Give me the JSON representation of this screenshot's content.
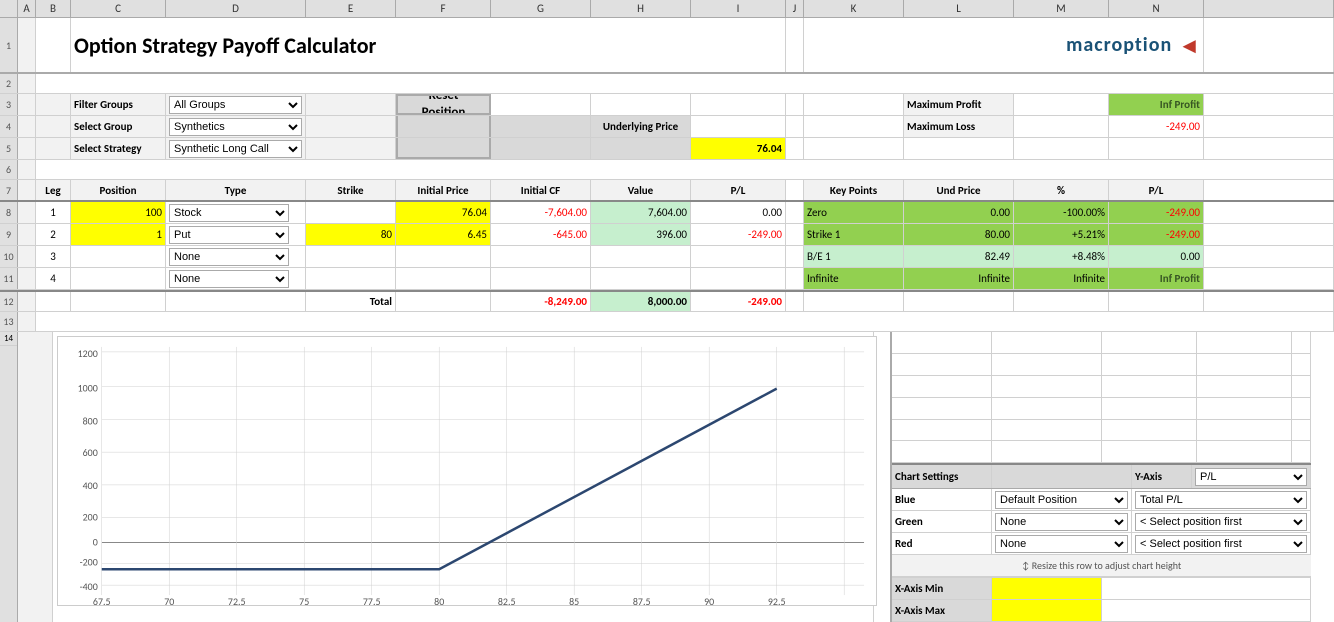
{
  "title": "Option Strategy Payoff Calculator",
  "logo": "macroption",
  "filters": {
    "filter_groups_label": "Filter Groups",
    "select_group_label": "Select Group",
    "select_strategy_label": "Select Strategy",
    "filter_groups_value": "All Groups",
    "select_group_value": "Synthetics",
    "select_strategy_value": "Synthetic Long Call",
    "filter_groups_options": [
      "All Groups"
    ],
    "select_group_options": [
      "Synthetics"
    ],
    "select_strategy_options": [
      "Synthetic Long Call"
    ]
  },
  "reset_button": "Reset\nPosition",
  "underlying_price_label": "Underlying Price",
  "underlying_price_value": "76.04",
  "table_headers": [
    "Leg",
    "Position",
    "Type",
    "Strike",
    "Initial Price",
    "Initial CF",
    "Value",
    "P/L"
  ],
  "legs": [
    {
      "leg": "1",
      "position": "100",
      "type": "Stock",
      "strike": "",
      "initial_price": "76.04",
      "initial_cf": "-7,604.00",
      "value": "7,604.00",
      "pl": "0.00"
    },
    {
      "leg": "2",
      "position": "1",
      "type": "Put",
      "strike": "80",
      "initial_price": "6.45",
      "initial_cf": "-645.00",
      "value": "396.00",
      "pl": "-249.00"
    },
    {
      "leg": "3",
      "position": "",
      "type": "None",
      "strike": "",
      "initial_price": "",
      "initial_cf": "",
      "value": "",
      "pl": ""
    },
    {
      "leg": "4",
      "position": "",
      "type": "None",
      "strike": "",
      "initial_price": "",
      "initial_cf": "",
      "value": "",
      "pl": ""
    }
  ],
  "totals": {
    "label": "Total",
    "initial_cf": "-8,249.00",
    "value": "8,000.00",
    "pl": "-249.00"
  },
  "key_points": {
    "headers": [
      "Key Points",
      "Und Price",
      "%",
      "P/L"
    ],
    "rows": [
      {
        "label": "Zero",
        "und_price": "0.00",
        "pct": "-100.00%",
        "pl": "-249.00"
      },
      {
        "label": "Strike 1",
        "und_price": "80.00",
        "pct": "+5.21%",
        "pl": "-249.00"
      },
      {
        "label": "B/E 1",
        "und_price": "82.49",
        "pct": "+8.48%",
        "pl": "0.00"
      },
      {
        "label": "Infinite",
        "und_price": "Infinite",
        "pct": "Infinite",
        "pl": "Inf Profit"
      }
    ]
  },
  "summary": {
    "maximum_profit_label": "Maximum Profit",
    "maximum_profit_value": "Inf Profit",
    "maximum_loss_label": "Maximum Loss",
    "maximum_loss_value": "-249.00"
  },
  "chart_settings": {
    "label": "Chart Settings",
    "y_axis_label": "Y-Axis",
    "y_axis_value": "P/L",
    "blue_label": "Blue",
    "blue_value": "Default Position",
    "blue_series": "Total P/L",
    "green_label": "Green",
    "green_value": "None",
    "green_series": "< Select position first",
    "red_label": "Red",
    "red_value": "None",
    "red_series": "< Select position first"
  },
  "axis": {
    "x_min_label": "X-Axis Min",
    "x_max_label": "X-Axis Max",
    "x_min_value": "",
    "x_max_value": "",
    "resize_note": "↕ Resize this row to adjust chart height",
    "x_ticks": [
      "67.5",
      "70",
      "72.5",
      "75",
      "77.5",
      "80",
      "82.5",
      "85",
      "87.5",
      "90",
      "92.5"
    ],
    "y_ticks": [
      "-400",
      "-200",
      "0",
      "200",
      "400",
      "600",
      "800",
      "1000",
      "1200"
    ]
  },
  "chart": {
    "data_points": [
      {
        "x": 67.5,
        "y": -249
      },
      {
        "x": 80,
        "y": -249
      },
      {
        "x": 92.5,
        "y": 1050
      }
    ]
  }
}
